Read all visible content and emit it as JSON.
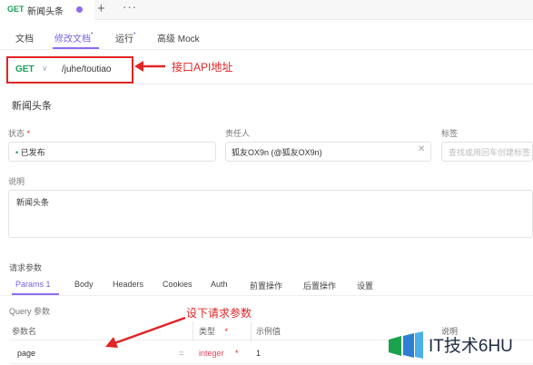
{
  "window": {
    "doc_tab": {
      "method": "GET",
      "title": "新闻头条"
    },
    "plus_symbol": "+",
    "more_symbol": "···"
  },
  "subtabs": [
    "文档",
    "修改文档",
    "运行",
    "高级 Mock"
  ],
  "subtab_dot": "•",
  "request": {
    "method": "GET",
    "method_chevron": "∨",
    "path": "/juhe/toutiao"
  },
  "annotations": {
    "url_note": "接口API地址",
    "params_note": "设下请求参数"
  },
  "api": {
    "name": "新闻头条"
  },
  "fields": {
    "status": {
      "label": "状态",
      "required_mark": "*",
      "dot": "•",
      "value": "已发布",
      "status_color": "#18a058"
    },
    "owner": {
      "label": "责任人",
      "value": "狐友OX9n (@狐友OX9n)"
    },
    "tags": {
      "label": "标签",
      "placeholder": "查找或用回车创建标签"
    },
    "description": {
      "label": "说明",
      "value": "新闻头条"
    }
  },
  "params": {
    "heading": "请求参数",
    "tabs": [
      {
        "label": "Params",
        "count": "1"
      },
      {
        "label": "Body"
      },
      {
        "label": "Headers"
      },
      {
        "label": "Cookies"
      },
      {
        "label": "Auth"
      },
      {
        "label": "前置操作"
      },
      {
        "label": "后置操作"
      },
      {
        "label": "设置"
      }
    ],
    "query_heading": "Query 参数",
    "columns": {
      "name": "参数名",
      "type": "类型",
      "type_required": "*",
      "example": "示例值",
      "desc": "说明"
    },
    "rows": [
      {
        "name": "page",
        "eq": "=",
        "type": "integer",
        "required": "*",
        "example": "1"
      }
    ]
  },
  "colors": {
    "accent": "#8e6cf0",
    "method_get": "#18a058",
    "annotation_red": "#e02525",
    "type_red": "#e0445a"
  },
  "watermark": {
    "text": "IT技术6HU"
  }
}
